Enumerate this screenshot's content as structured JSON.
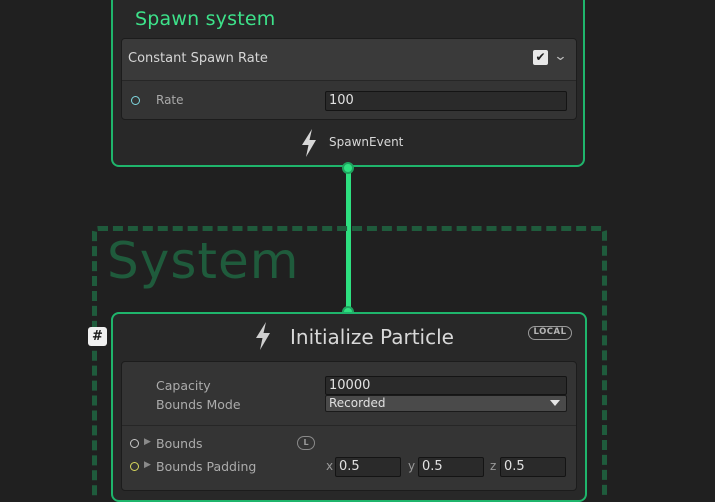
{
  "spawn_system": {
    "title": "Spawn system",
    "block": {
      "title": "Constant Spawn Rate",
      "enabled_check": "✔",
      "collapse_icon": "chevron-down-icon",
      "chevron": "⌄"
    },
    "rate": {
      "label": "Rate",
      "value": "100"
    },
    "event_label": "SpawnEvent",
    "event_icon": "lightning-icon"
  },
  "system_group": {
    "title": "System",
    "badge": "#"
  },
  "initialize": {
    "title": "Initialize Particle",
    "space_badge": "LOCAL",
    "event_icon": "lightning-icon",
    "capacity": {
      "label": "Capacity",
      "value": "10000"
    },
    "bounds_mode": {
      "label": "Bounds Mode",
      "value": "Recorded"
    },
    "bounds": {
      "label": "Bounds",
      "space_badge": "L"
    },
    "bounds_padding": {
      "label": "Bounds Padding",
      "x_label": "x",
      "x": "0.5",
      "y_label": "y",
      "y": "0.5",
      "z_label": "z",
      "z": "0.5"
    }
  },
  "colors": {
    "background": "#202020",
    "node_border": "#1fb56c",
    "spawn_title": "#3de28a",
    "connector": "#2ee080",
    "system_group": "#1f5b3c"
  }
}
